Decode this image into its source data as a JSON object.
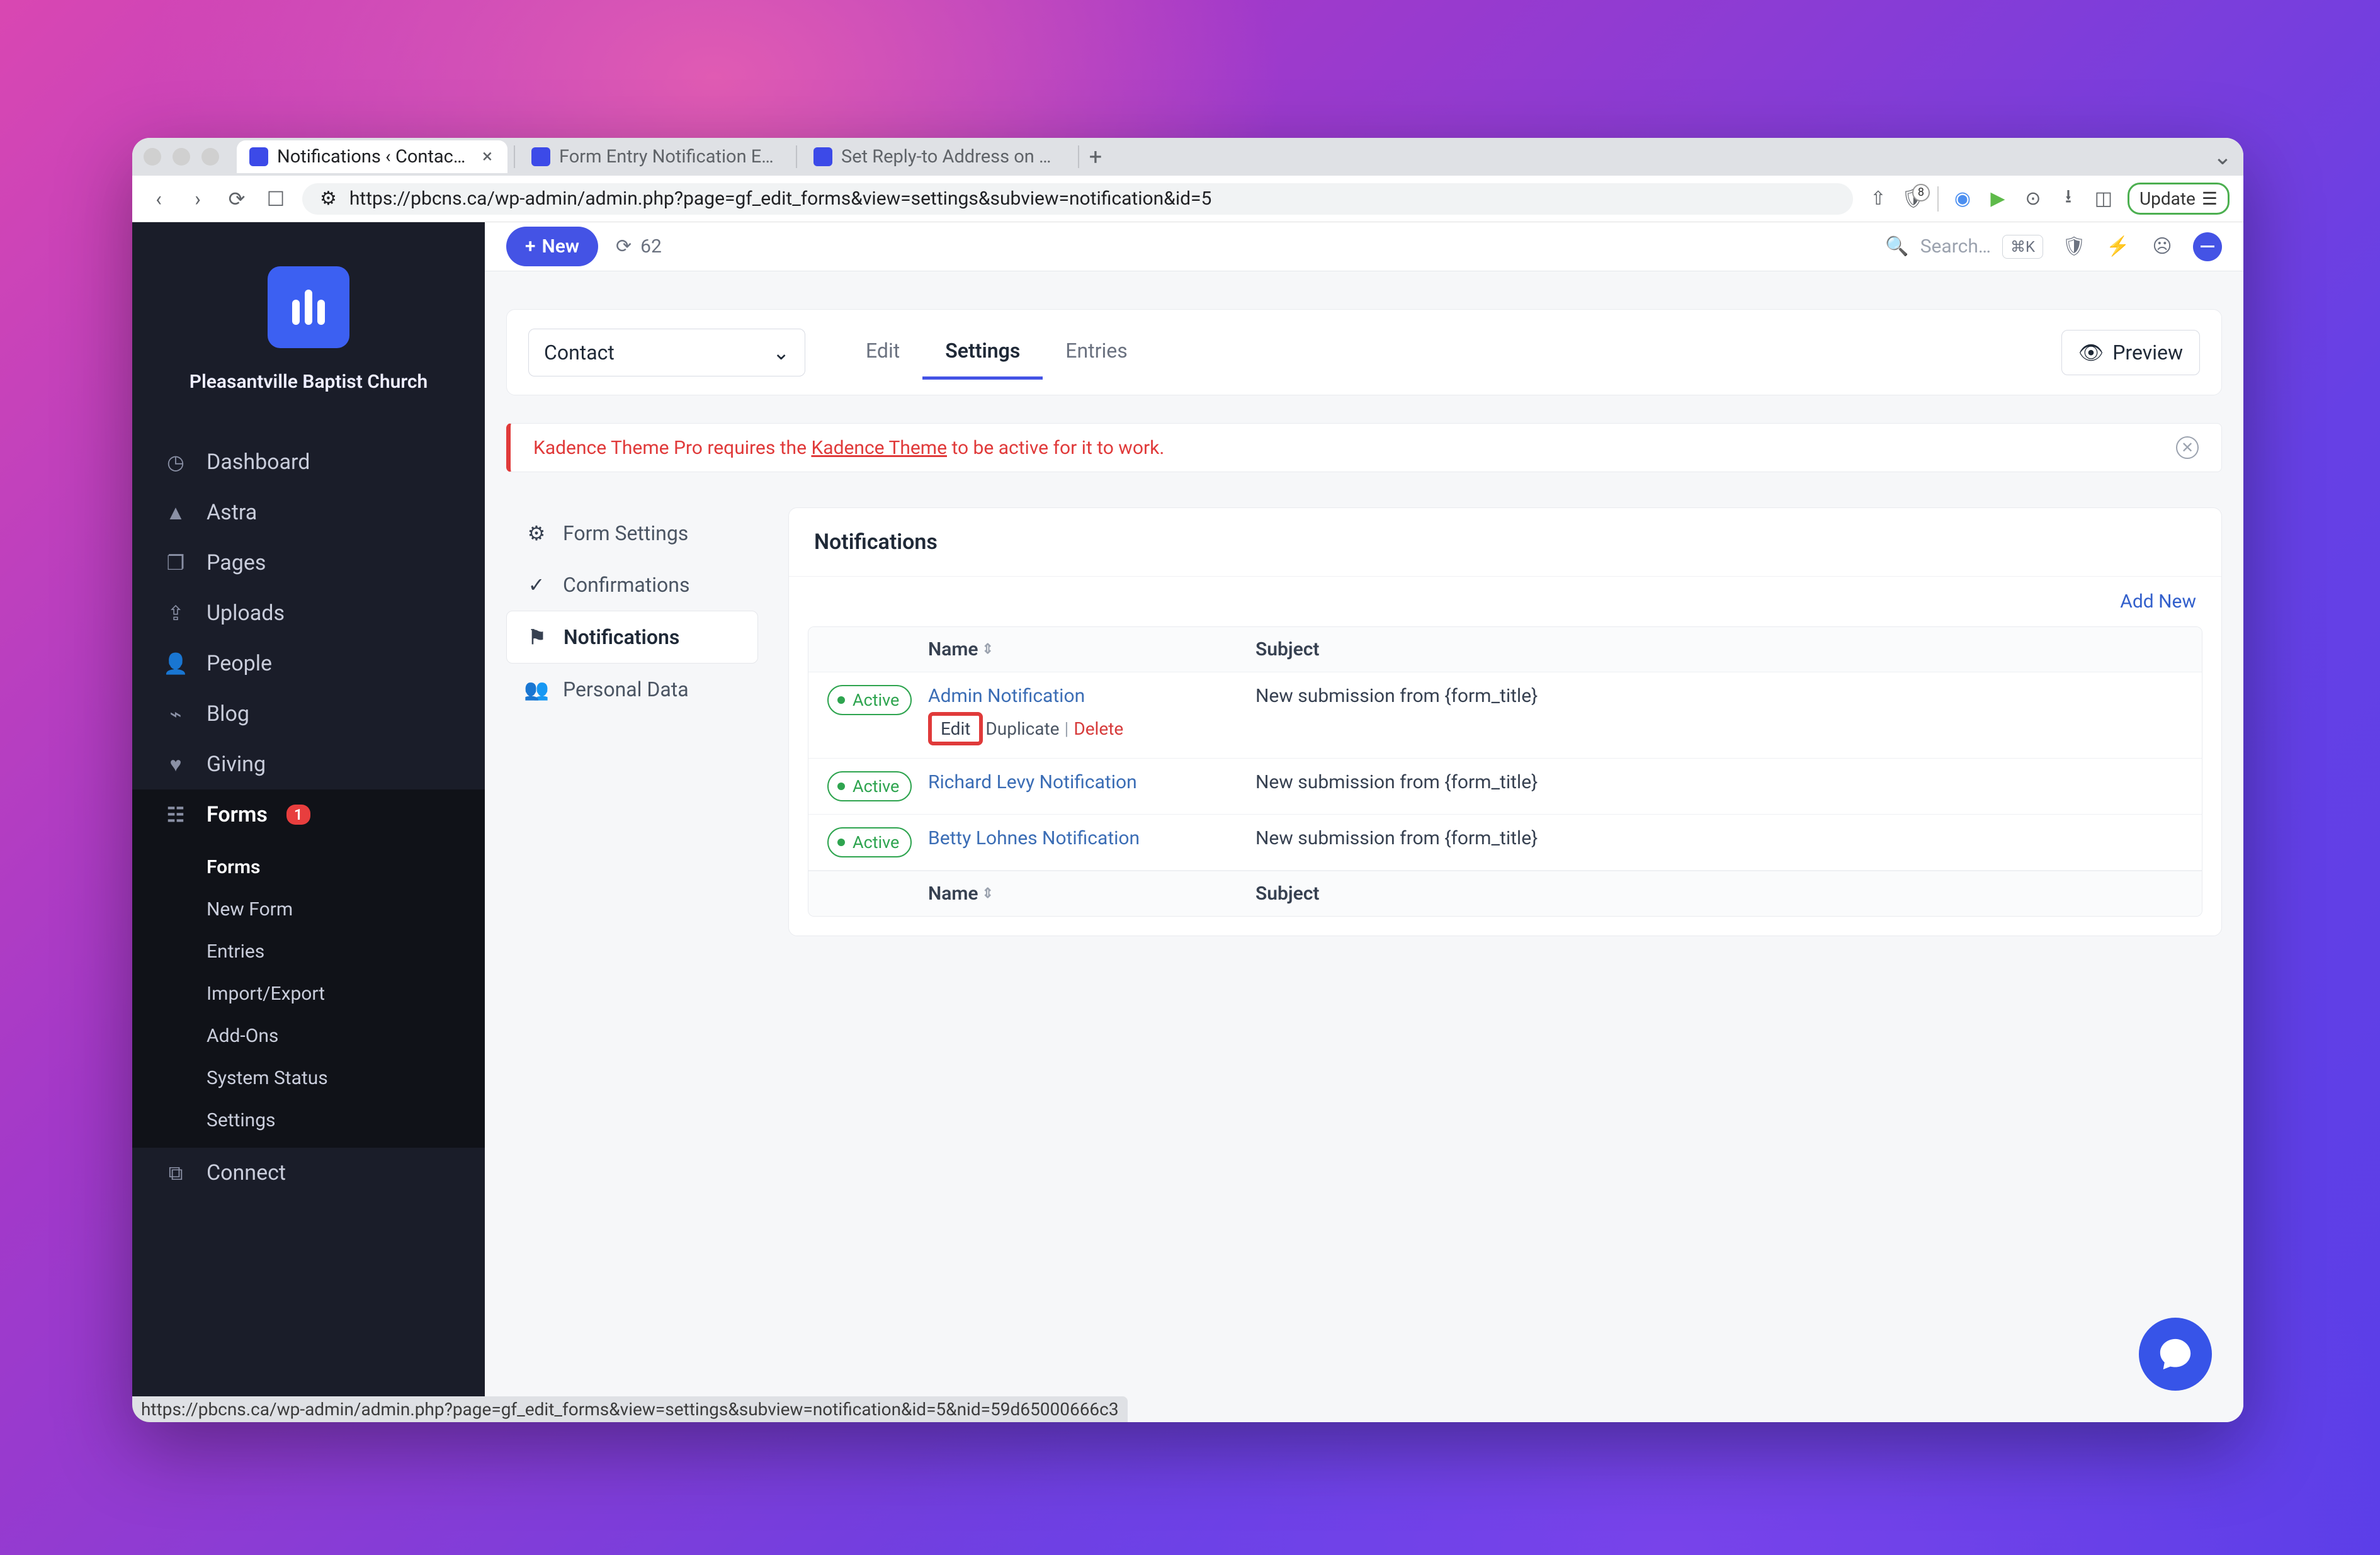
{
  "browser": {
    "tabs": [
      {
        "title": "Notifications ‹ Contact ‹ Form",
        "active": true
      },
      {
        "title": "Form Entry Notification Emails | D",
        "active": false
      },
      {
        "title": "Set Reply-to Address on Notificat",
        "active": false
      }
    ],
    "url": "https://pbcns.ca/wp-admin/admin.php?page=gf_edit_forms&view=settings&subview=notification&id=5",
    "shield_count": "8",
    "update_label": "Update",
    "status_url": "https://pbcns.ca/wp-admin/admin.php?page=gf_edit_forms&view=settings&subview=notification&id=5&nid=59d65000666c3"
  },
  "sidebar": {
    "site_name": "Pleasantville Baptist Church",
    "items": [
      {
        "icon": "dashboard-icon",
        "label": "Dashboard"
      },
      {
        "icon": "astra-icon",
        "label": "Astra"
      },
      {
        "icon": "pages-icon",
        "label": "Pages"
      },
      {
        "icon": "uploads-icon",
        "label": "Uploads"
      },
      {
        "icon": "people-icon",
        "label": "People"
      },
      {
        "icon": "blog-icon",
        "label": "Blog"
      },
      {
        "icon": "giving-icon",
        "label": "Giving"
      },
      {
        "icon": "forms-icon",
        "label": "Forms",
        "badge": "1",
        "active": true
      }
    ],
    "sub_items": [
      {
        "label": "Forms",
        "active": true
      },
      {
        "label": "New Form"
      },
      {
        "label": "Entries"
      },
      {
        "label": "Import/Export"
      },
      {
        "label": "Add-Ons"
      },
      {
        "label": "System Status"
      },
      {
        "label": "Settings"
      }
    ],
    "connect": {
      "label": "Connect"
    }
  },
  "topbar": {
    "new_label": "New",
    "refresh_count": "62",
    "search_placeholder": "Search…",
    "kbd": "⌘K"
  },
  "form_header": {
    "form_name": "Contact",
    "tabs": [
      {
        "label": "Edit"
      },
      {
        "label": "Settings",
        "active": true
      },
      {
        "label": "Entries"
      }
    ],
    "preview_label": "Preview"
  },
  "alert": {
    "text_before": "Kadence Theme Pro requires the ",
    "link_text": "Kadence Theme",
    "text_after": " to be active for it to work."
  },
  "settings_nav": [
    {
      "icon": "gear-icon",
      "label": "Form Settings"
    },
    {
      "icon": "check-circle-icon",
      "label": "Confirmations"
    },
    {
      "icon": "flag-icon",
      "label": "Notifications",
      "active": true
    },
    {
      "icon": "people-icon",
      "label": "Personal Data"
    }
  ],
  "panel": {
    "title": "Notifications",
    "add_new": "Add New",
    "columns": {
      "name": "Name",
      "subject": "Subject"
    },
    "rows": [
      {
        "status": "Active",
        "name": "Admin Notification",
        "subject": "New submission from {form_title}",
        "actions": {
          "edit": "Edit",
          "duplicate": "Duplicate",
          "delete": "Delete",
          "show": true
        }
      },
      {
        "status": "Active",
        "name": "Richard Levy Notification",
        "subject": "New submission from {form_title}"
      },
      {
        "status": "Active",
        "name": "Betty Lohnes Notification",
        "subject": "New submission from {form_title}"
      }
    ]
  }
}
